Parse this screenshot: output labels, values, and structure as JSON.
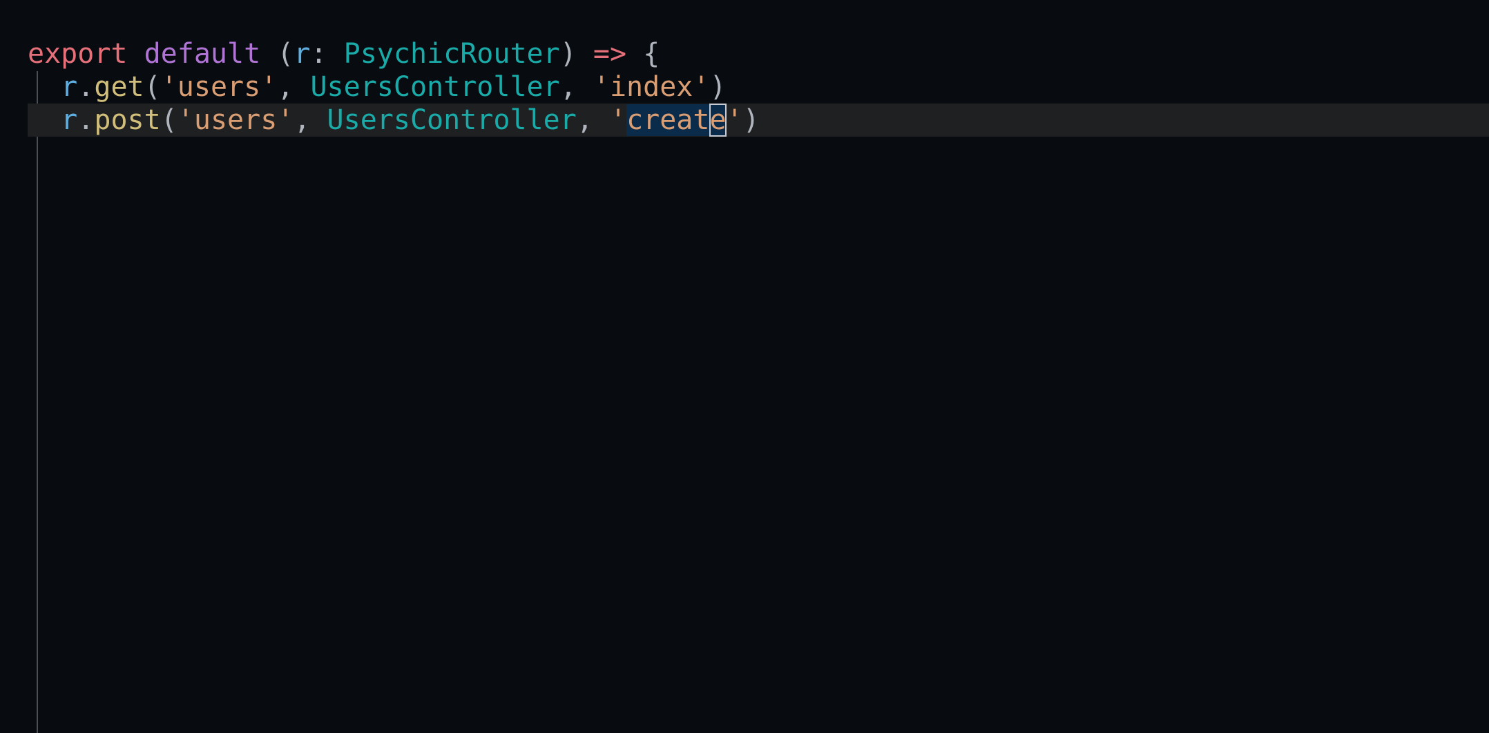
{
  "code": {
    "line1": {
      "kw_export": "export",
      "kw_default": "default",
      "open_paren": "(",
      "param": "r",
      "colon": ":",
      "type": "PsychicRouter",
      "close_paren": ")",
      "arrow": "=>",
      "brace": "{"
    },
    "line2": {
      "obj": "r",
      "dot": ".",
      "method": "get",
      "open_paren": "(",
      "path": "'users'",
      "comma1": ",",
      "controller": "UsersController",
      "comma2": ",",
      "action": "'index'",
      "close_paren": ")"
    },
    "line3": {
      "obj": "r",
      "dot": ".",
      "method": "post",
      "open_paren": "(",
      "path": "'users'",
      "comma1": ",",
      "controller": "UsersController",
      "comma2": ",",
      "action_quote_open": "'",
      "action_selected": "creat",
      "action_cursor_char": "e",
      "action_quote_close": "'",
      "close_paren": ")"
    }
  },
  "colors": {
    "background": "#080b10",
    "keyword_export": "#e5707a",
    "keyword_default": "#b074d5",
    "type": "#1aaaa8",
    "param": "#5eaee0",
    "method": "#d1be7a",
    "string": "#d99e73",
    "selection": "#0b2b4b",
    "current_line": "#1f2022"
  }
}
